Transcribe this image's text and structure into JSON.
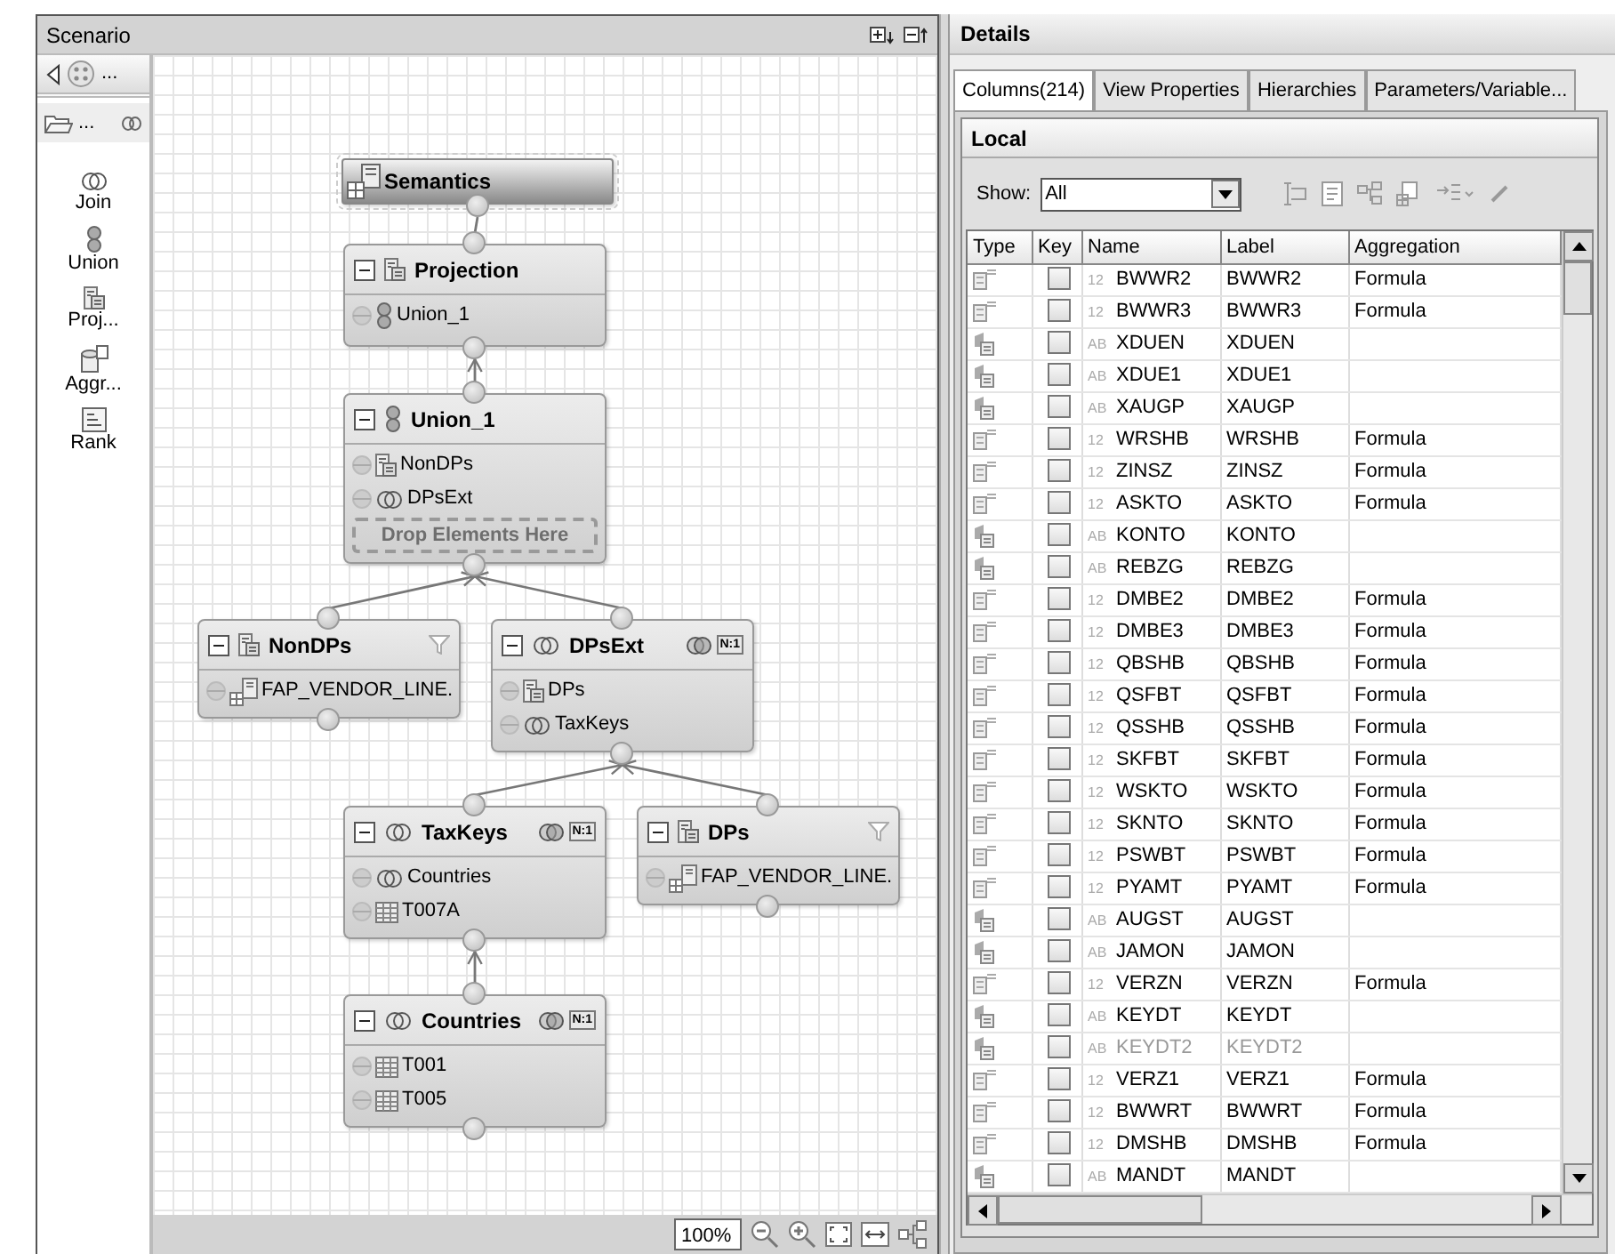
{
  "scenario": {
    "title": "Scenario",
    "palette": {
      "top_label": "...",
      "folder_label": "...",
      "tools": [
        {
          "label": "Join",
          "kind": "join"
        },
        {
          "label": "Union",
          "kind": "union"
        },
        {
          "label": "Proj...",
          "kind": "projection"
        },
        {
          "label": "Aggr...",
          "kind": "aggregation"
        },
        {
          "label": "Rank",
          "kind": "rank"
        }
      ]
    },
    "diagram": {
      "root": {
        "name": "Semantics",
        "kind": "semantics",
        "children": [
          {
            "name": "Projection",
            "kind": "projection",
            "items": [
              {
                "label": "Union_1",
                "kind": "union"
              }
            ],
            "children": [
              {
                "name": "Union_1",
                "kind": "union",
                "items": [
                  {
                    "label": "NonDPs",
                    "kind": "projection"
                  },
                  {
                    "label": "DPsExt",
                    "kind": "join"
                  }
                ],
                "drop_hint": "Drop Elements Here",
                "children": [
                  {
                    "name": "NonDPs",
                    "kind": "projection",
                    "filter": true,
                    "items": [
                      {
                        "label": "FAP_VENDOR_LINE.",
                        "kind": "view"
                      }
                    ]
                  },
                  {
                    "name": "DPsExt",
                    "kind": "join",
                    "cardinality": "N:1",
                    "items": [
                      {
                        "label": "DPs",
                        "kind": "projection"
                      },
                      {
                        "label": "TaxKeys",
                        "kind": "join"
                      }
                    ],
                    "children": [
                      {
                        "name": "TaxKeys",
                        "kind": "join",
                        "cardinality": "N:1",
                        "items": [
                          {
                            "label": "Countries",
                            "kind": "join"
                          },
                          {
                            "label": "T007A",
                            "kind": "table"
                          }
                        ],
                        "children": [
                          {
                            "name": "Countries",
                            "kind": "join",
                            "cardinality": "N:1",
                            "items": [
                              {
                                "label": "T001",
                                "kind": "table"
                              },
                              {
                                "label": "T005",
                                "kind": "table"
                              }
                            ]
                          }
                        ]
                      },
                      {
                        "name": "DPs",
                        "kind": "projection",
                        "filter": true,
                        "items": [
                          {
                            "label": "FAP_VENDOR_LINE.",
                            "kind": "view"
                          }
                        ]
                      }
                    ]
                  }
                ]
              }
            ]
          }
        ]
      }
    },
    "zoom": "100%"
  },
  "details": {
    "title": "Details",
    "tabs": [
      {
        "label": "Columns(214)",
        "selected": true
      },
      {
        "label": "View Properties",
        "selected": false
      },
      {
        "label": "Hierarchies",
        "selected": false
      },
      {
        "label": "Parameters/Variable...",
        "selected": false
      }
    ],
    "section": "Local",
    "show_label": "Show:",
    "show_value": "All",
    "columns": [
      "Type",
      "Key",
      "Name",
      "Label",
      "Aggregation"
    ],
    "rows": [
      {
        "kind": "measure",
        "key": false,
        "datatype": "12",
        "name": "BWWR2",
        "label": "BWWR2",
        "aggregation": "Formula",
        "disabled": false
      },
      {
        "kind": "measure",
        "key": false,
        "datatype": "12",
        "name": "BWWR3",
        "label": "BWWR3",
        "aggregation": "Formula",
        "disabled": false
      },
      {
        "kind": "attribute",
        "key": false,
        "datatype": "AB",
        "name": "XDUEN",
        "label": "XDUEN",
        "disabled": false
      },
      {
        "kind": "attribute",
        "key": false,
        "datatype": "AB",
        "name": "XDUE1",
        "label": "XDUE1",
        "disabled": false
      },
      {
        "kind": "attribute",
        "key": false,
        "datatype": "AB",
        "name": "XAUGP",
        "label": "XAUGP",
        "disabled": false
      },
      {
        "kind": "measure",
        "key": false,
        "datatype": "12",
        "name": "WRSHB",
        "label": "WRSHB",
        "aggregation": "Formula",
        "disabled": false
      },
      {
        "kind": "measure",
        "key": false,
        "datatype": "12",
        "name": "ZINSZ",
        "label": "ZINSZ",
        "aggregation": "Formula",
        "disabled": false
      },
      {
        "kind": "measure",
        "key": false,
        "datatype": "12",
        "name": "ASKTO",
        "label": "ASKTO",
        "aggregation": "Formula",
        "disabled": false
      },
      {
        "kind": "attribute",
        "key": false,
        "datatype": "AB",
        "name": "KONTO",
        "label": "KONTO",
        "disabled": false
      },
      {
        "kind": "attribute",
        "key": false,
        "datatype": "AB",
        "name": "REBZG",
        "label": "REBZG",
        "disabled": false
      },
      {
        "kind": "measure",
        "key": false,
        "datatype": "12",
        "name": "DMBE2",
        "label": "DMBE2",
        "aggregation": "Formula",
        "disabled": false
      },
      {
        "kind": "measure",
        "key": false,
        "datatype": "12",
        "name": "DMBE3",
        "label": "DMBE3",
        "aggregation": "Formula",
        "disabled": false
      },
      {
        "kind": "measure",
        "key": false,
        "datatype": "12",
        "name": "QBSHB",
        "label": "QBSHB",
        "aggregation": "Formula",
        "disabled": false
      },
      {
        "kind": "measure",
        "key": false,
        "datatype": "12",
        "name": "QSFBT",
        "label": "QSFBT",
        "aggregation": "Formula",
        "disabled": false
      },
      {
        "kind": "measure",
        "key": false,
        "datatype": "12",
        "name": "QSSHB",
        "label": "QSSHB",
        "aggregation": "Formula",
        "disabled": false
      },
      {
        "kind": "measure",
        "key": false,
        "datatype": "12",
        "name": "SKFBT",
        "label": "SKFBT",
        "aggregation": "Formula",
        "disabled": false
      },
      {
        "kind": "measure",
        "key": false,
        "datatype": "12",
        "name": "WSKTO",
        "label": "WSKTO",
        "aggregation": "Formula",
        "disabled": false
      },
      {
        "kind": "measure",
        "key": false,
        "datatype": "12",
        "name": "SKNTO",
        "label": "SKNTO",
        "aggregation": "Formula",
        "disabled": false
      },
      {
        "kind": "measure",
        "key": false,
        "datatype": "12",
        "name": "PSWBT",
        "label": "PSWBT",
        "aggregation": "Formula",
        "disabled": false
      },
      {
        "kind": "measure",
        "key": false,
        "datatype": "12",
        "name": "PYAMT",
        "label": "PYAMT",
        "aggregation": "Formula",
        "disabled": false
      },
      {
        "kind": "attribute",
        "key": false,
        "datatype": "AB",
        "name": "AUGST",
        "label": "AUGST",
        "disabled": false
      },
      {
        "kind": "attribute",
        "key": false,
        "datatype": "AB",
        "name": "JAMON",
        "label": "JAMON",
        "disabled": false
      },
      {
        "kind": "measure",
        "key": false,
        "datatype": "12",
        "name": "VERZN",
        "label": "VERZN",
        "aggregation": "Formula",
        "disabled": false
      },
      {
        "kind": "attribute",
        "key": false,
        "datatype": "AB",
        "name": "KEYDT",
        "label": "KEYDT",
        "disabled": false
      },
      {
        "kind": "attribute",
        "key": false,
        "datatype": "AB",
        "name": "KEYDT2",
        "label": "KEYDT2",
        "disabled": true
      },
      {
        "kind": "measure",
        "key": false,
        "datatype": "12",
        "name": "VERZ1",
        "label": "VERZ1",
        "aggregation": "Formula",
        "disabled": false
      },
      {
        "kind": "measure",
        "key": false,
        "datatype": "12",
        "name": "BWWRT",
        "label": "BWWRT",
        "aggregation": "Formula",
        "disabled": false
      },
      {
        "kind": "measure",
        "key": false,
        "datatype": "12",
        "name": "DMSHB",
        "label": "DMSHB",
        "aggregation": "Formula",
        "disabled": false
      },
      {
        "kind": "attribute",
        "key": false,
        "datatype": "AB",
        "name": "MANDT",
        "label": "MANDT",
        "disabled": false
      }
    ]
  }
}
